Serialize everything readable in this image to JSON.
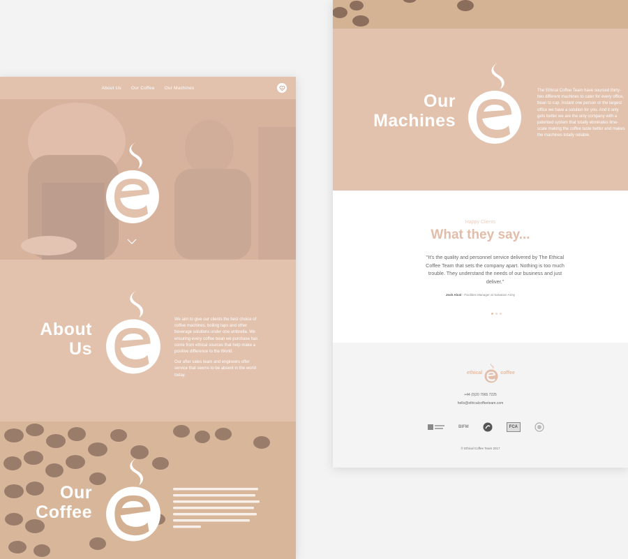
{
  "left_page": {
    "nav": {
      "items": [
        "About Us",
        "Our Coffee",
        "Our Machines"
      ],
      "badge_icon": "heart-badge-icon"
    },
    "hero": {
      "logo_icon": "ethical-e-logo-icon",
      "scroll_icon": "chevron-down-icon"
    },
    "about": {
      "title_line1": "About",
      "title_line2": "Us",
      "paragraph1": "We aim to give our clients the best choice of coffee machines, boiling taps and other beverage solutions under one umbrella. We ensuring every coffee bean we purchase has come from ethical sources that help make a positive difference to the World.",
      "paragraph2": "Our after sales team and engineers offer service that seems to be absent in the world today."
    },
    "coffee": {
      "title_line1": "Our",
      "title_line2": "Coffee"
    }
  },
  "right_page": {
    "machines": {
      "title_line1": "Our",
      "title_line2": "Machines",
      "paragraph": "The Ethical Coffee Team have sourced thirty-two different machines to cater for every office, bean to cup. Instant one person or the largest office we have a solution for you. And it only gets better we are the only company with a patented system that totally eliminates lime-scale making the coffee taste better and makes the machines totally reliable."
    },
    "testimonials": {
      "kicker": "Happy Clients",
      "title": "What they say...",
      "quote": "\"It's the quality and personnel service delivered by The Ethical Coffee Team that sets the company apart. Nothing is too much trouble. They understand the needs of our business and just deliver.\"",
      "author": "Josh Alcol",
      "author_role": " - Facilities Manager at Salvation Army",
      "dots_count": 3
    },
    "footer": {
      "logo_left": "ethical",
      "logo_right": "coffee",
      "phone": "+44 (0)20 7965 7225",
      "email": "hello@ethicalcoffeeteam.com",
      "partners": [
        "BIFM",
        "FCA"
      ],
      "copyright": "© Ethical Coffee Team 2017"
    }
  },
  "colors": {
    "brand_peach": "#e2c1ad",
    "title_peach": "#e2bda9",
    "footer_bg": "#f4f4f4"
  }
}
